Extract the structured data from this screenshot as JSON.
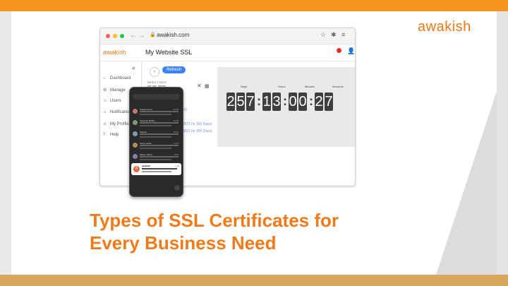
{
  "brand": {
    "logo_text": "awakish",
    "accent": "#f07a1a"
  },
  "browser": {
    "url": "awakish.com",
    "app_logo": "awakish",
    "page_title": "My Website SSL",
    "collapse_glyph": "«",
    "sidebar": [
      {
        "label": "Dashboard",
        "icon": "home-icon"
      },
      {
        "label": "Manage",
        "icon": "manage-icon"
      },
      {
        "label": "Users",
        "icon": "users-icon"
      },
      {
        "label": "Notification",
        "icon": "bell-icon"
      },
      {
        "label": "My Profile",
        "icon": "profile-icon"
      },
      {
        "label": "Help",
        "icon": "help-icon"
      }
    ],
    "refresh_label": "Refresh",
    "field_label": "RESULT DATE",
    "field_value": "07-06-2022",
    "date_rows": [
      "2022",
      "n-2022 (in 300 Days)",
      "n-2022 (in 300 Days)"
    ],
    "timer": {
      "labels": [
        "Days",
        "Hours",
        "Minutes",
        "Seconds"
      ],
      "days": "257",
      "hours": "13",
      "minutes": "00",
      "seconds": "27"
    }
  },
  "phone": {
    "rows": [
      {
        "name": "Joseph Hood",
        "time": "12:30",
        "color": "#c0796a"
      },
      {
        "name": "Jameson Bobby",
        "time": "11:45",
        "color": "#7a9c7a"
      },
      {
        "name": "Dakota",
        "time": "10:20",
        "color": "#7aa0b8"
      },
      {
        "name": "Jorge Leeds",
        "time": "9:15",
        "color": "#b88a5a"
      },
      {
        "name": "Mason Wood",
        "time": "8:05",
        "color": "#8a7ab8"
      }
    ],
    "notification": {
      "avatar_letter": "A",
      "title": "Awakish",
      "time": "now"
    }
  },
  "headline": {
    "line1": "Types of SSL Certificates for",
    "line2": "Every Business Need"
  }
}
